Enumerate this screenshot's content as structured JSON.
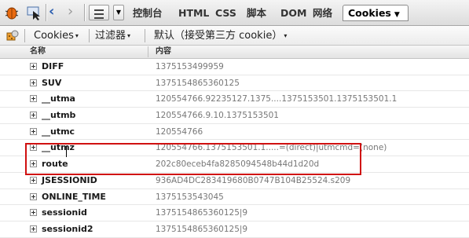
{
  "toolbar": {
    "tabs": [
      {
        "label": "控制台"
      },
      {
        "label": "HTML"
      },
      {
        "label": "CSS"
      },
      {
        "label": "脚本"
      },
      {
        "label": "DOM"
      },
      {
        "label": "网络"
      },
      {
        "label": "Cookies",
        "active": true
      }
    ]
  },
  "cookies_toolbar": {
    "cookies_menu": "Cookies",
    "filter_menu": "过滤器",
    "default_menu": "默认（接受第三方 cookie）"
  },
  "table": {
    "headers": {
      "name": "名称",
      "value": "内容"
    },
    "rows": [
      {
        "name": "DIFF",
        "value": "1375153499959"
      },
      {
        "name": "SUV",
        "value": "1375154865360125"
      },
      {
        "name": "__utma",
        "value": "120554766.92235127.1375....1375153501.1375153501.1"
      },
      {
        "name": "__utmb",
        "value": "120554766.9.10.1375153501"
      },
      {
        "name": "__utmc",
        "value": "120554766"
      },
      {
        "name": "__utmz",
        "value": "120554766.1375153501.1.....=(direct)|utmcmd=(none)"
      },
      {
        "name": "route",
        "value": "202c80eceb4fa8285094548b44d1d20d"
      },
      {
        "name": "JSESSIONID",
        "value": "936AD4DC283419680B0747B104B25524.s209"
      },
      {
        "name": "ONLINE_TIME",
        "value": "1375153543045"
      },
      {
        "name": "sessionid",
        "value": "1375154865360125|9"
      },
      {
        "name": "sessionid2",
        "value": "1375154865360125|9"
      }
    ]
  },
  "colors": {
    "highlight": "#d01010"
  }
}
